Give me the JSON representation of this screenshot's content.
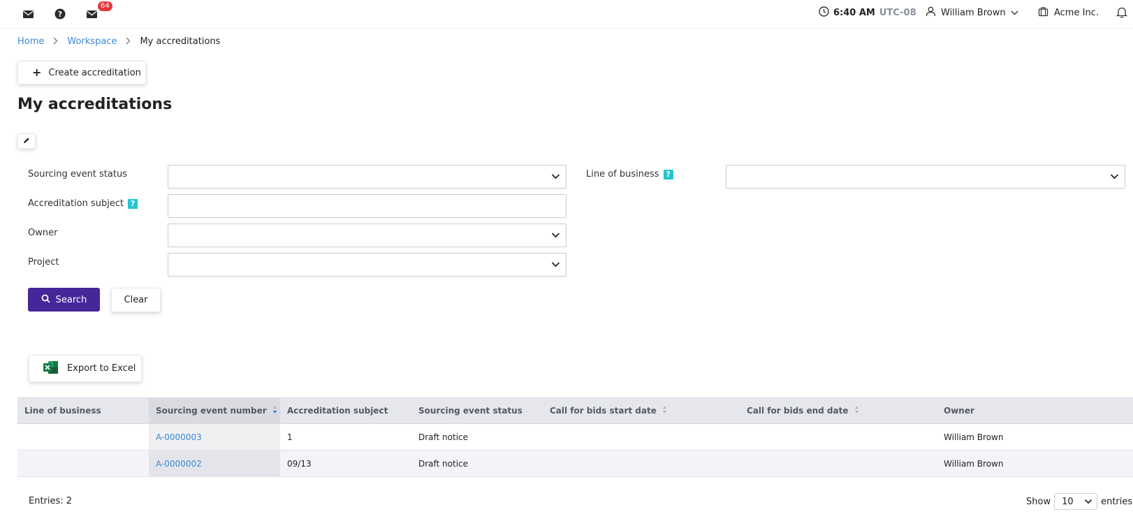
{
  "topbar": {
    "notification_count": "64",
    "time": "6:40 AM",
    "timezone": "UTC-08",
    "user_name": "William Brown",
    "organization": "Acme Inc."
  },
  "breadcrumb": {
    "home": "Home",
    "workspace": "Workspace",
    "current": "My accreditations"
  },
  "actions": {
    "create_label": "Create accreditation",
    "export_label": "Export to Excel"
  },
  "page": {
    "title": "My accreditations"
  },
  "form": {
    "sourcing_event_status_label": "Sourcing event status",
    "line_of_business_label": "Line of business",
    "accreditation_subject_label": "Accreditation subject",
    "owner_label": "Owner",
    "project_label": "Project",
    "search_label": "Search",
    "clear_label": "Clear"
  },
  "table": {
    "columns": [
      "Line of business",
      "Sourcing event number",
      "Accreditation subject",
      "Sourcing event status",
      "Call for bids start date",
      "Call for bids end date",
      "Owner"
    ],
    "rows": [
      {
        "line_of_business": "",
        "number": "A-0000003",
        "subject": "1",
        "status": "Draft notice",
        "start": "",
        "end": "",
        "owner": "William Brown"
      },
      {
        "line_of_business": "",
        "number": "A-0000002",
        "subject": "09/13",
        "status": "Draft notice",
        "start": "",
        "end": "",
        "owner": "William Brown"
      }
    ]
  },
  "footer": {
    "entries_text": "Entries: 2",
    "show_label": "Show",
    "page_size": "10",
    "entries_label": "entries"
  },
  "colors": {
    "primary": "#46279a",
    "link": "#3a8ad6",
    "badge": "#e5383b",
    "help": "#24c4d0",
    "excel": "#1d7044"
  }
}
